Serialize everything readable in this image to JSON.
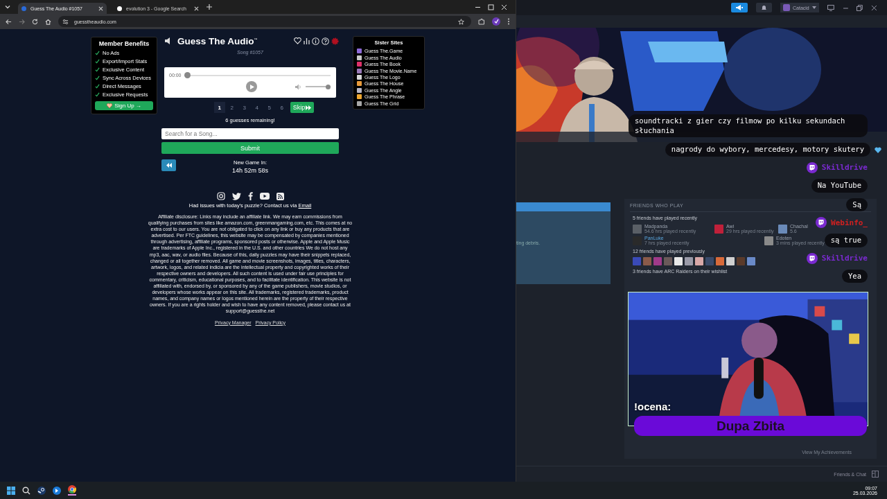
{
  "browser": {
    "tabs": [
      {
        "title": "Guess The Audio #1057",
        "selected": true
      },
      {
        "title": "evolution 3 - Google Search",
        "selected": false
      }
    ],
    "url": "guesstheaudio.com"
  },
  "benefits": {
    "title": "Member Benefits",
    "items": [
      "No Ads",
      "Export/Import Stats",
      "Exclusive Content",
      "Sync Across Devices",
      "Direct Messages",
      "Exclusive Requests"
    ],
    "signup": "Sign Up →"
  },
  "game": {
    "title": "Guess The Audio$^{™}$",
    "song": "Song #1057",
    "player": {
      "time": "00:00",
      "progress": {
        "level": 0
      },
      "volume": {
        "level": 1
      }
    },
    "guesses": [
      {
        "label": "1",
        "selected": true
      },
      {
        "label": "2",
        "selected": false
      },
      {
        "label": "3",
        "selected": false
      },
      {
        "label": "4",
        "selected": false
      },
      {
        "label": "5",
        "selected": false
      },
      {
        "label": "6",
        "selected": false
      }
    ],
    "skip": "Skip",
    "remaining": "6 guesses remaining!",
    "search_placeholder": "Search for a Song...",
    "submit": "Submit",
    "countdown_label": "New Game In:",
    "countdown": "14h 52m 58s",
    "contact": "Had issues with today's puzzle? Contact us via",
    "contact_link": "Email",
    "disclosure": "Affiliate disclosure: Links may include an affiliate link. We may earn commissions from qualifying purchases from sites like amazon.com, greenmangaming.com, etc. This comes at no extra cost to our users. You are not obligated to click on any link or buy any products that are advertised. Per FTC guidelines, this website may be compensated by companies mentioned through advertising, affiliate programs, sponsored posts or otherwise. Apple and Apple Music are trademarks of Apple Inc., registered in the U.S. and other countries We do not host any mp3, aac, wav, or audio files. Because of this, daily puzzles may have their snippets replaced, changed or all together removed. All game and movie screenshots, images, titles, characters, artwork, logos, and related indicia are the intellectual property and copyrighted works of their respective owners and developers. All such content is used under fair use principles for commentary, criticism, educational purposes, and to facilitate identification. This website is not affiliated with, endorsed by, or sponsored by any of the game publishers, movie studios, or developers whose works appear on this site. All trademarks, registered trademarks, product names, and company names or logos mentioned herein are the property of their respective owners. If you are a rights holder and wish to have any content removed, please contact us at support@guessthe.net",
    "footer_links": [
      "Privacy Manager",
      "Privacy Policy"
    ]
  },
  "sister_sites": {
    "title": "Sister Sites",
    "items": [
      {
        "label": "Guess The.Game",
        "color": "#8e6ad8"
      },
      {
        "label": "Guess The Audio",
        "color": "#c8c8c8"
      },
      {
        "label": "Guess The Book",
        "color": "#e0306a"
      },
      {
        "label": "Guess The Movie.Name",
        "color": "#9a7ab8"
      },
      {
        "label": "Guess The Logo",
        "color": "#d8d8d8"
      },
      {
        "label": "Guess The House",
        "color": "#e89a3a"
      },
      {
        "label": "Guess The Angle",
        "color": "#b8b8c8"
      },
      {
        "label": "Guess The Phrase",
        "color": "#f0a830"
      },
      {
        "label": "Guess The Grid",
        "color": "#a8a8a8"
      }
    ]
  },
  "steam": {
    "account": "Catacid",
    "left_snippet": "ting debris.",
    "friends": {
      "title": "FRIENDS WHO PLAY",
      "recent_heading": "5 friends have played recently",
      "recent": [
        {
          "name": "Madpanda",
          "detail": "54.6 hrs played recently",
          "online": false,
          "color": "#5a5f66"
        },
        {
          "name": "Awi",
          "detail": "29 hrs played recently",
          "online": false,
          "color": "#c0203a"
        },
        {
          "name": "Chachal",
          "detail": "5.6",
          "online": false,
          "color": "#6a8ab8"
        },
        {
          "name": "PanLuke",
          "detail": "7 hrs played recently",
          "online": true,
          "color": "#2a2a2a"
        },
        {
          "name": "Edoten",
          "detail": "3 mins played recently",
          "online": false,
          "color": "#8a8a8a"
        }
      ],
      "previous_heading": "12 friends have played previously",
      "previous": [
        {
          "color": "#3a4ab8"
        },
        {
          "color": "#8a5a4a"
        },
        {
          "color": "#a03a8a"
        },
        {
          "color": "#6a5a5a"
        },
        {
          "color": "#e8e8e8"
        },
        {
          "color": "#9a9aa8"
        },
        {
          "color": "#d8a8a8"
        },
        {
          "color": "#3a4a6a"
        },
        {
          "color": "#d86a3a"
        },
        {
          "color": "#d0d0d0"
        },
        {
          "color": "#5a3a2a"
        },
        {
          "color": "#6a8ac8"
        }
      ],
      "wishlist_heading": "3 friends have ARC Raiders on their wishlist",
      "achievements": "View My Achievements"
    },
    "friends_chat": "Friends & Chat"
  },
  "chat": [
    {
      "kind": "message",
      "text": "soundtracki z gier czy filmow po kilku sekundach słuchania"
    },
    {
      "kind": "message",
      "text": "nagrody do wybory, mercedesy, motory skutery",
      "liked": true
    },
    {
      "kind": "user",
      "text": "Skilldrive",
      "color": "#7a2ad0"
    },
    {
      "kind": "message",
      "text": "Na YouTube"
    },
    {
      "kind": "message",
      "text": "Są"
    },
    {
      "kind": "user",
      "text": "Webinfo_",
      "color": "#d02020"
    },
    {
      "kind": "message",
      "text": "są true"
    },
    {
      "kind": "user",
      "text": "Skilldrive",
      "color": "#7a2ad0"
    },
    {
      "kind": "message",
      "text": "Yea"
    }
  ],
  "overlay": {
    "label": "!ocena:",
    "rating": "Dupa Zbita"
  },
  "taskbar": {
    "time": "09:07",
    "date": "25.03.2026"
  }
}
